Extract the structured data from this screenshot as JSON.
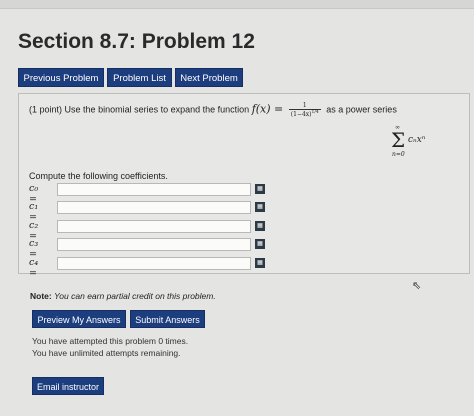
{
  "page": {
    "title": "Section 8.7: Problem 12"
  },
  "nav": {
    "previous": "Previous Problem",
    "list": "Problem List",
    "next": "Next Problem"
  },
  "problem": {
    "points": "(1 point)",
    "statement_pre": "Use the binomial series to expand the function",
    "function_lhs": "f(x) =",
    "frac_num": "1",
    "frac_den": "(1−4x)",
    "frac_den_exp": "1/4",
    "statement_post": "as a power series",
    "sum_upper": "∞",
    "sum_symbol": "Σ",
    "sum_lower": "n=0",
    "sum_term": "cₙxⁿ",
    "compute_label": "Compute the following coefficients.",
    "coefficients": [
      {
        "label": "c₀ =",
        "value": ""
      },
      {
        "label": "c₁ =",
        "value": ""
      },
      {
        "label": "c₂ =",
        "value": ""
      },
      {
        "label": "c₃ =",
        "value": ""
      },
      {
        "label": "c₄ =",
        "value": ""
      }
    ],
    "kbd_glyph": "▦"
  },
  "note": {
    "label": "Note:",
    "text": "You can earn partial credit on this problem."
  },
  "actions": {
    "preview": "Preview My Answers",
    "submit": "Submit Answers"
  },
  "attempts": {
    "line1": "You have attempted this problem 0 times.",
    "line2": "You have unlimited attempts remaining."
  },
  "email": {
    "label": "Email instructor"
  }
}
